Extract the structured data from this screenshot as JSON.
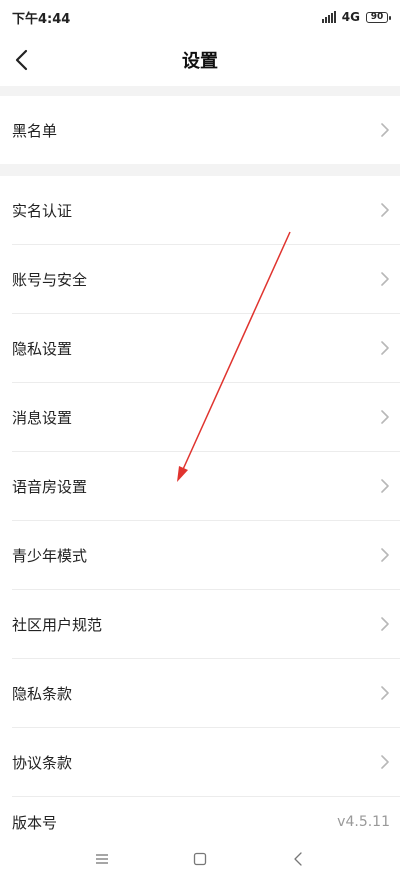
{
  "status_bar": {
    "time": "下午4:44",
    "network": "4G",
    "battery": "90"
  },
  "header": {
    "title": "设置"
  },
  "settings": {
    "blacklist": "黑名单",
    "items": [
      {
        "label": "实名认证"
      },
      {
        "label": "账号与安全"
      },
      {
        "label": "隐私设置"
      },
      {
        "label": "消息设置"
      },
      {
        "label": "语音房设置"
      },
      {
        "label": "青少年模式"
      },
      {
        "label": "社区用户规范"
      },
      {
        "label": "隐私条款"
      },
      {
        "label": "协议条款"
      }
    ],
    "version": {
      "label": "版本号",
      "value": "v4.5.11"
    }
  },
  "colors": {
    "annotation": "#e0342f",
    "chevron": "#b8b8b8"
  }
}
